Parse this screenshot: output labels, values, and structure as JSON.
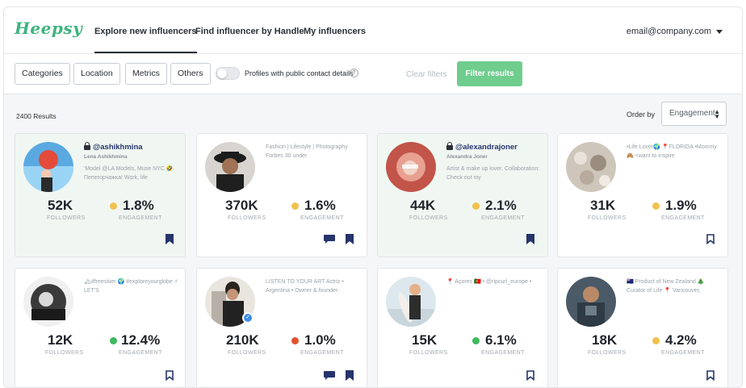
{
  "app": {
    "logo": "Heepsy"
  },
  "nav": {
    "tabs": [
      {
        "label": "Explore new influencers",
        "active": true
      },
      {
        "label": "Find influencer by Handle",
        "active": false
      },
      {
        "label": "My influencers",
        "active": false
      }
    ],
    "user_email": "email@company.com"
  },
  "filters": {
    "buttons": [
      "Categories",
      "Location",
      "Metrics",
      "Others"
    ],
    "toggle_label": "Profiles with public contact details",
    "toggle_on": false,
    "clear_label": "Clear filters",
    "apply_label": "Filter results"
  },
  "results": {
    "count": "2400 Results",
    "order_label": "Order by",
    "order_value": "Engagement"
  },
  "labels": {
    "followers": "FOLLOWERS",
    "engagement": "ENGAGEMENT"
  },
  "colors": {
    "accent": "#3fb37f",
    "yellow": "#f2c14e",
    "green": "#3fba5e",
    "red": "#e2532e",
    "bookmark": "#26346b"
  },
  "cards": [
    {
      "handle": "@ashikhmina",
      "name": "Lena Ashikhmina",
      "bio": "'Model @LA Models, Muse NYC 🤣 Пепегорчажка! Work, life",
      "followers": "52K",
      "engagement": "1.8%",
      "dot": "yellow",
      "highlight": true,
      "locked": true,
      "chat": false,
      "verified": false
    },
    {
      "handle": "",
      "name": "",
      "bio": "Fashion | Lifestyle | Photography Forbes 30 under",
      "followers": "370K",
      "engagement": "1.6%",
      "dot": "yellow",
      "highlight": false,
      "locked": false,
      "chat": true,
      "verified": false
    },
    {
      "handle": "@alexandrajoner",
      "name": "Alexandra Joner",
      "bio": "Artist & make up lover. Collaboration: Check out my",
      "followers": "44K",
      "engagement": "2.1%",
      "dot": "yellow",
      "highlight": true,
      "locked": true,
      "chat": false,
      "verified": false
    },
    {
      "handle": "",
      "name": "",
      "bio": "•Life Lover🌍 📍FLORIDA •Mommy 🙈 <want to inspire",
      "followers": "31K",
      "engagement": "1.9%",
      "dot": "yellow",
      "highlight": false,
      "locked": false,
      "chat": false,
      "verified": false
    },
    {
      "handle": "",
      "name": "",
      "bio": "🏔#freeskier 🌍 #exploreyourglobe ⚡ LET'S",
      "followers": "12K",
      "engagement": "12.4%",
      "dot": "green",
      "highlight": false,
      "locked": false,
      "chat": false,
      "verified": false
    },
    {
      "handle": "",
      "name": "",
      "bio": "LISTEN TO YOUR ART Actriz • Argentina • Owner & founder:",
      "followers": "210K",
      "engagement": "1.0%",
      "dot": "red",
      "highlight": false,
      "locked": false,
      "chat": true,
      "verified": true
    },
    {
      "handle": "",
      "name": "",
      "bio": "📍 Açores 🇵🇹 • @ripcurl_europe •",
      "followers": "15K",
      "engagement": "6.1%",
      "dot": "green",
      "highlight": false,
      "locked": false,
      "chat": false,
      "verified": false
    },
    {
      "handle": "",
      "name": "",
      "bio": "🇳🇿 Product of New Zealand 🎄 Curator of Life 📍 Vancouver,",
      "followers": "18K",
      "engagement": "4.2%",
      "dot": "yellow",
      "highlight": false,
      "locked": false,
      "chat": false,
      "verified": false
    }
  ]
}
